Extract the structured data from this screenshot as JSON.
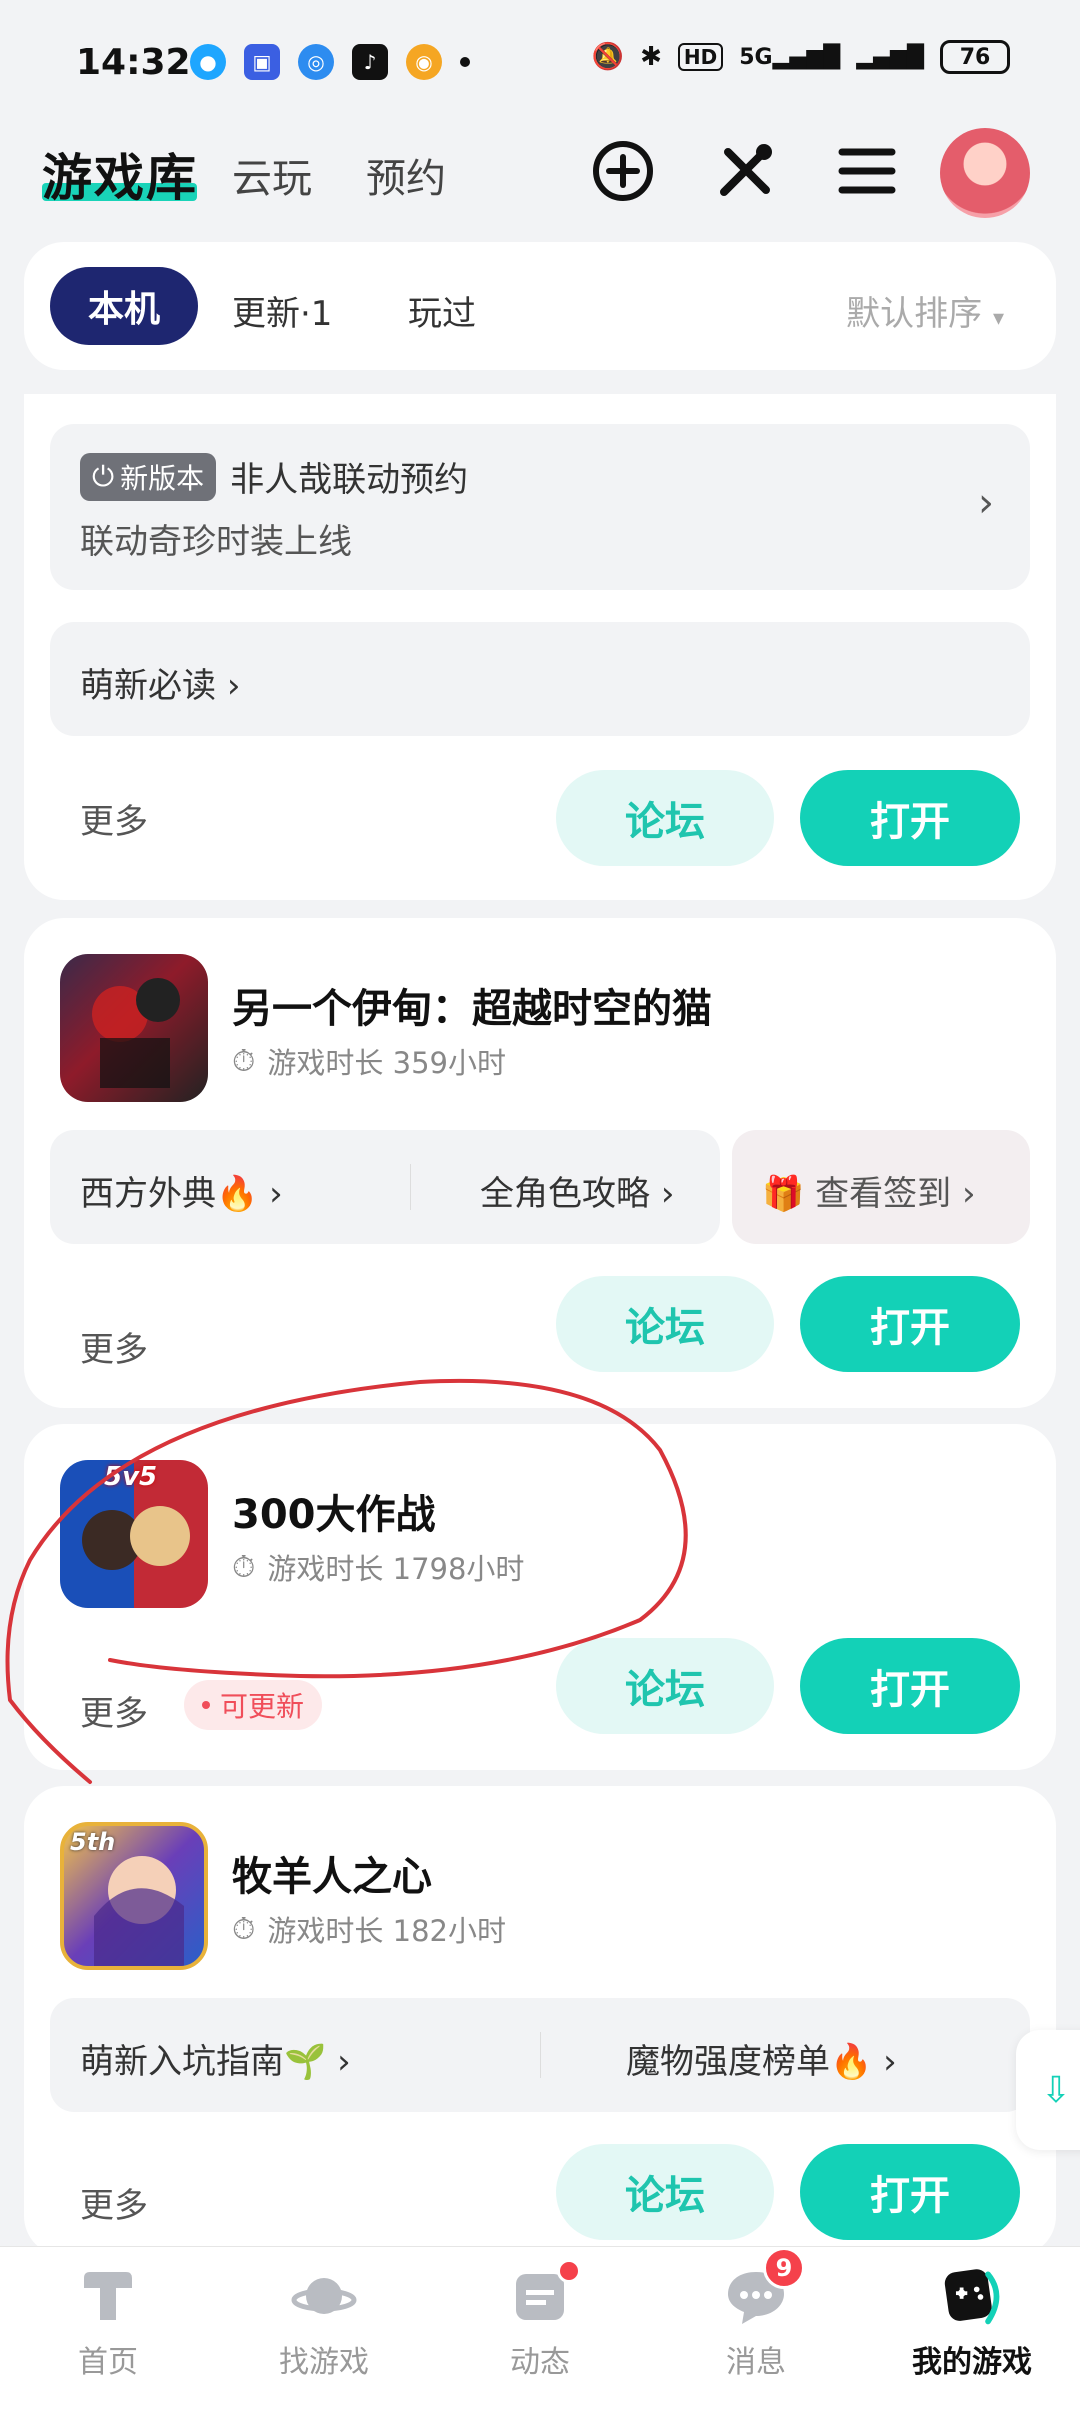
{
  "status_bar": {
    "time": "14:32",
    "battery": "76",
    "network": "5G"
  },
  "header": {
    "title": "游戏库",
    "tabs": [
      "云玩",
      "预约"
    ]
  },
  "filter": {
    "chips": [
      "本机",
      "更新·1",
      "玩过"
    ],
    "sort": "默认排序"
  },
  "card1": {
    "new_version_tag": "新版本",
    "banner_title": "非人哉联动预约",
    "banner_sub": "联动奇珍时装上线",
    "guide_link": "萌新必读",
    "more": "更多",
    "forum": "论坛",
    "open": "打开"
  },
  "card2": {
    "name": "另一个伊甸：超越时空的猫",
    "playtime": "游戏时长 359小时",
    "link1": "西方外典🔥",
    "link2": "全角色攻略",
    "checkin": "查看签到",
    "more": "更多",
    "forum": "论坛",
    "open": "打开"
  },
  "card3": {
    "name": "300大作战",
    "playtime": "游戏时长 1798小时",
    "icon_badge": "5v5",
    "update_pill": "可更新",
    "more": "更多",
    "forum": "论坛",
    "open": "打开"
  },
  "card4": {
    "name": "牧羊人之心",
    "playtime": "游戏时长 182小时",
    "icon_badge": "5th",
    "link1": "萌新入坑指南🌱",
    "link2": "魔物强度榜单🔥",
    "more": "更多",
    "forum": "论坛",
    "open": "打开"
  },
  "bottom_nav": {
    "items": [
      "首页",
      "找游戏",
      "动态",
      "消息",
      "我的游戏"
    ],
    "message_badge": "9"
  },
  "colors": {
    "accent": "#13d1b7",
    "chip_active": "#1e2670",
    "annotation": "#d8343a"
  }
}
